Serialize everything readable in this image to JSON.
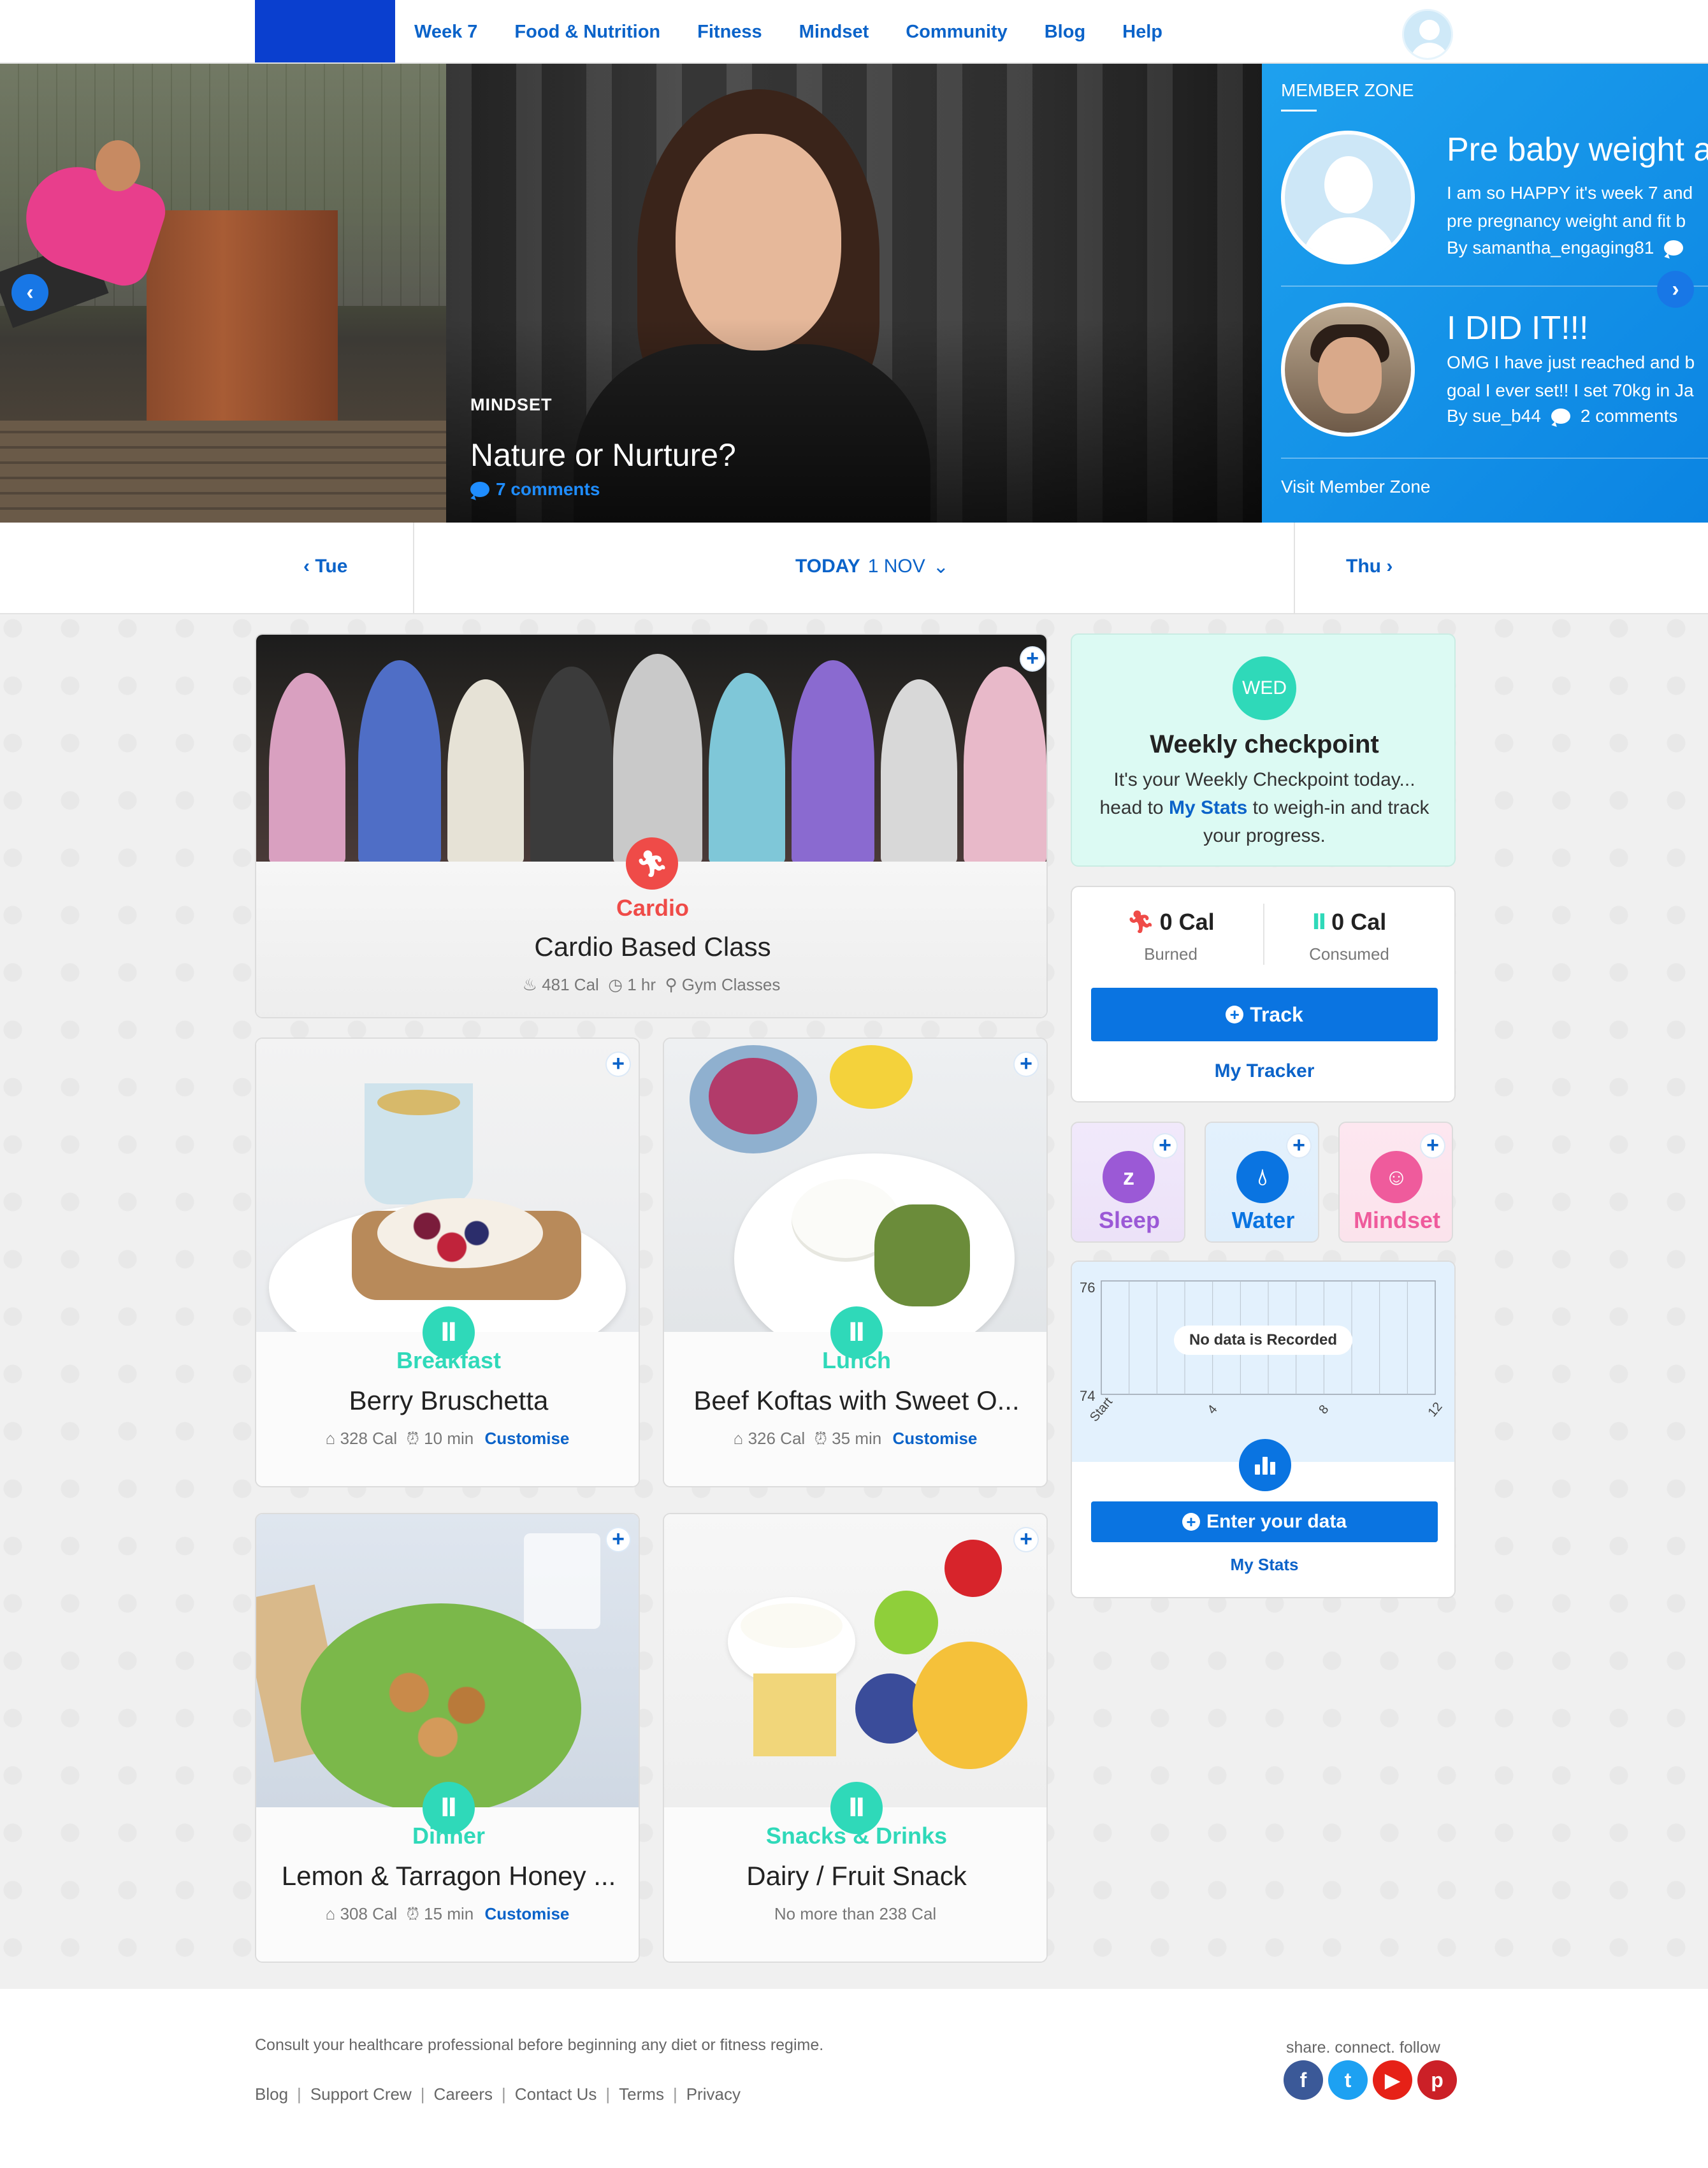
{
  "nav": {
    "items": [
      "Week 7",
      "Food & Nutrition",
      "Fitness",
      "Mindset",
      "Community",
      "Blog",
      "Help"
    ]
  },
  "hero": {
    "category": "MINDSET",
    "title": "Nature or Nurture?",
    "comments": "7 comments"
  },
  "member_zone": {
    "label": "MEMBER ZONE",
    "posts": [
      {
        "title": "Pre baby weight a",
        "text_line1": "I am so HAPPY it's week 7 and",
        "text_line2": "pre pregnancy weight and fit b",
        "author": "By samantha_engaging81"
      },
      {
        "title": "I DID IT!!!",
        "text_line1": "OMG I have just reached and b",
        "text_line2": "goal I ever set!! I set 70kg in Ja",
        "author": "By sue_b44",
        "comments": "2 comments"
      }
    ],
    "visit": "Visit Member Zone"
  },
  "datebar": {
    "prev": "Tue",
    "today_label": "TODAY",
    "today_date": "1 NOV",
    "next": "Thu"
  },
  "cardio": {
    "type": "Cardio",
    "title": "Cardio Based Class",
    "cal": "481 Cal",
    "duration": "1 hr",
    "location": "Gym Classes"
  },
  "meals": [
    {
      "type": "Breakfast",
      "title": "Berry Bruschetta",
      "cal": "328 Cal",
      "time": "10 min",
      "action": "Customise"
    },
    {
      "type": "Lunch",
      "title": "Beef Koftas with Sweet O...",
      "cal": "326 Cal",
      "time": "35 min",
      "action": "Customise"
    },
    {
      "type": "Dinner",
      "title": "Lemon & Tarragon Honey ...",
      "cal": "308 Cal",
      "time": "15 min",
      "action": "Customise"
    },
    {
      "type": "Snacks & Drinks",
      "title": "Dairy / Fruit Snack",
      "note": "No more than 238 Cal"
    }
  ],
  "checkpoint": {
    "badge": "WED",
    "title": "Weekly checkpoint",
    "text_before": "It's your Weekly Checkpoint today... head to ",
    "link": "My Stats",
    "text_after": " to weigh-in and track your progress."
  },
  "tracker": {
    "burned_value": "0 Cal",
    "burned_label": "Burned",
    "consumed_value": "0 Cal",
    "consumed_label": "Consumed",
    "track_button": "Track",
    "link": "My Tracker"
  },
  "quick": {
    "sleep": "Sleep",
    "water": "Water",
    "mindset": "Mindset"
  },
  "stats": {
    "empty_message": "No data is Recorded",
    "enter_button": "Enter your data",
    "link": "My Stats"
  },
  "chart_data": {
    "type": "line",
    "x_ticks": [
      "Start",
      "4",
      "8",
      "12"
    ],
    "y_ticks": [
      "76",
      "74"
    ],
    "ylim": [
      74,
      76
    ],
    "series": [],
    "grid": true,
    "annotation": "No data is Recorded"
  },
  "footer": {
    "disclaimer": "Consult your healthcare professional before beginning any diet or fitness regime.",
    "links": [
      "Blog",
      "Support Crew",
      "Careers",
      "Contact Us",
      "Terms",
      "Privacy"
    ],
    "share": "share. connect. follow"
  },
  "colors": {
    "brand_blue": "#0a74e1",
    "cardio_red": "#ef4b48",
    "meal_teal": "#2fd9b9",
    "sleep_purple": "#9b59d6",
    "mindset_pink": "#ef5b9c"
  }
}
